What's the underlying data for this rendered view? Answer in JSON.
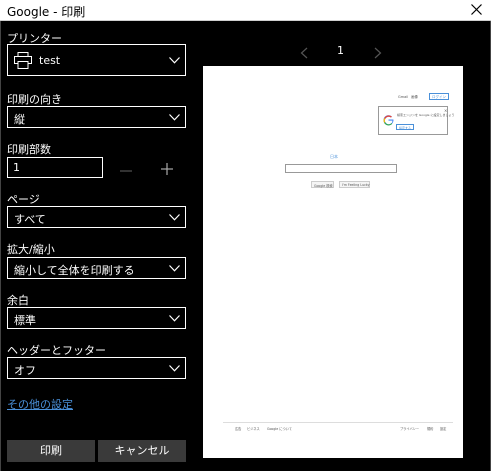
{
  "window": {
    "title": "Google - 印刷"
  },
  "printer": {
    "label": "プリンター",
    "value": "test"
  },
  "orientation": {
    "label": "印刷の向き",
    "value": "縦"
  },
  "copies": {
    "label": "印刷部数",
    "value": "1"
  },
  "pages": {
    "label": "ページ",
    "value": "すべて"
  },
  "scale": {
    "label": "拡大/縮小",
    "value": "縮小して全体を印刷する"
  },
  "margins": {
    "label": "余白",
    "value": "標準"
  },
  "header_footer": {
    "label": "ヘッダーとフッター",
    "value": "オフ"
  },
  "more_settings": "その他の設定",
  "buttons": {
    "print": "印刷",
    "cancel": "キャンセル"
  },
  "preview": {
    "page_number": "1",
    "header_links": [
      "Gmail",
      "画像"
    ],
    "signin": "ログイン",
    "popup_text": "検索エンジンを Google に設定しましょう",
    "popup_button": "設定する",
    "logo_text": "日本",
    "search_button": "Google 検索",
    "lucky_button": "I'm Feeling Lucky",
    "footer_left": [
      "広告",
      "ビジネス",
      "Google について"
    ],
    "footer_right": [
      "プライバシー",
      "規約",
      "設定"
    ]
  },
  "colors": {
    "accent_link": "#4a90d9",
    "button_bg": "#3a3a3a",
    "panel_bg": "#000000"
  }
}
